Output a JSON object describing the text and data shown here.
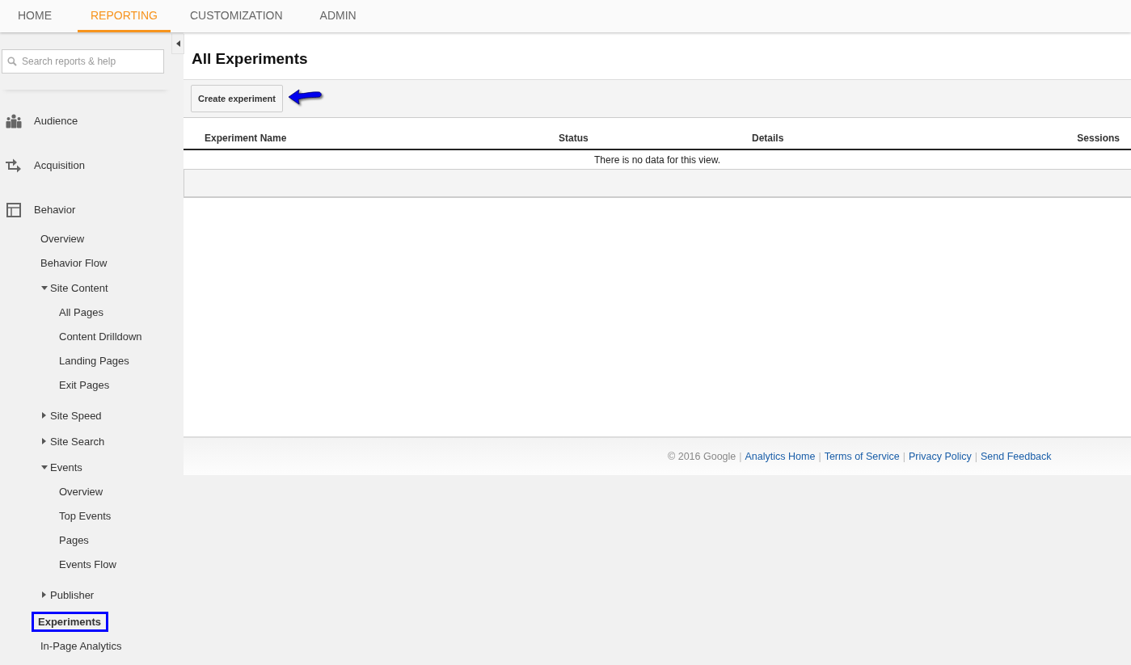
{
  "tabs": [
    {
      "label": "HOME",
      "selected": false
    },
    {
      "label": "REPORTING",
      "selected": true
    },
    {
      "label": "CUSTOMIZATION",
      "selected": false
    },
    {
      "label": "ADMIN",
      "selected": false
    }
  ],
  "search": {
    "placeholder": "Search reports & help"
  },
  "nav": [
    {
      "label": "Audience",
      "kind": "audience"
    },
    {
      "label": "Acquisition",
      "kind": "acquisition"
    },
    {
      "label": "Behavior",
      "kind": "behavior",
      "children": [
        {
          "label": "Overview",
          "selected": false
        },
        {
          "label": "Behavior Flow",
          "selected": false
        },
        {
          "label": "Site Content",
          "selected": false,
          "expanded": true,
          "children": [
            {
              "label": "All Pages",
              "selected": false
            },
            {
              "label": "Content Drilldown",
              "selected": false
            },
            {
              "label": "Landing Pages",
              "selected": false
            },
            {
              "label": "Exit Pages",
              "selected": false
            }
          ]
        },
        {
          "label": "Site Speed",
          "selected": false,
          "expanded": false
        },
        {
          "label": "Site Search",
          "selected": false,
          "expanded": false
        },
        {
          "label": "Events",
          "selected": false,
          "expanded": true,
          "children": [
            {
              "label": "Overview",
              "selected": false
            },
            {
              "label": "Top Events",
              "selected": false
            },
            {
              "label": "Pages",
              "selected": false
            },
            {
              "label": "Events Flow",
              "selected": false
            }
          ]
        },
        {
          "label": "Publisher",
          "selected": false,
          "expanded": false
        },
        {
          "label": "Experiments",
          "selected": true
        },
        {
          "label": "In-Page Analytics",
          "selected": false
        }
      ]
    }
  ],
  "page": {
    "title": "All Experiments",
    "button": "Create experiment"
  },
  "table": {
    "columns": [
      "Experiment Name",
      "Status",
      "Details",
      "Sessions"
    ],
    "empty_message": "There is no data for this view."
  },
  "footer": {
    "copyright": "© 2016 Google",
    "separator": "|",
    "links": [
      "Analytics Home",
      "Terms of Service",
      "Privacy Policy",
      "Send Feedback"
    ]
  }
}
